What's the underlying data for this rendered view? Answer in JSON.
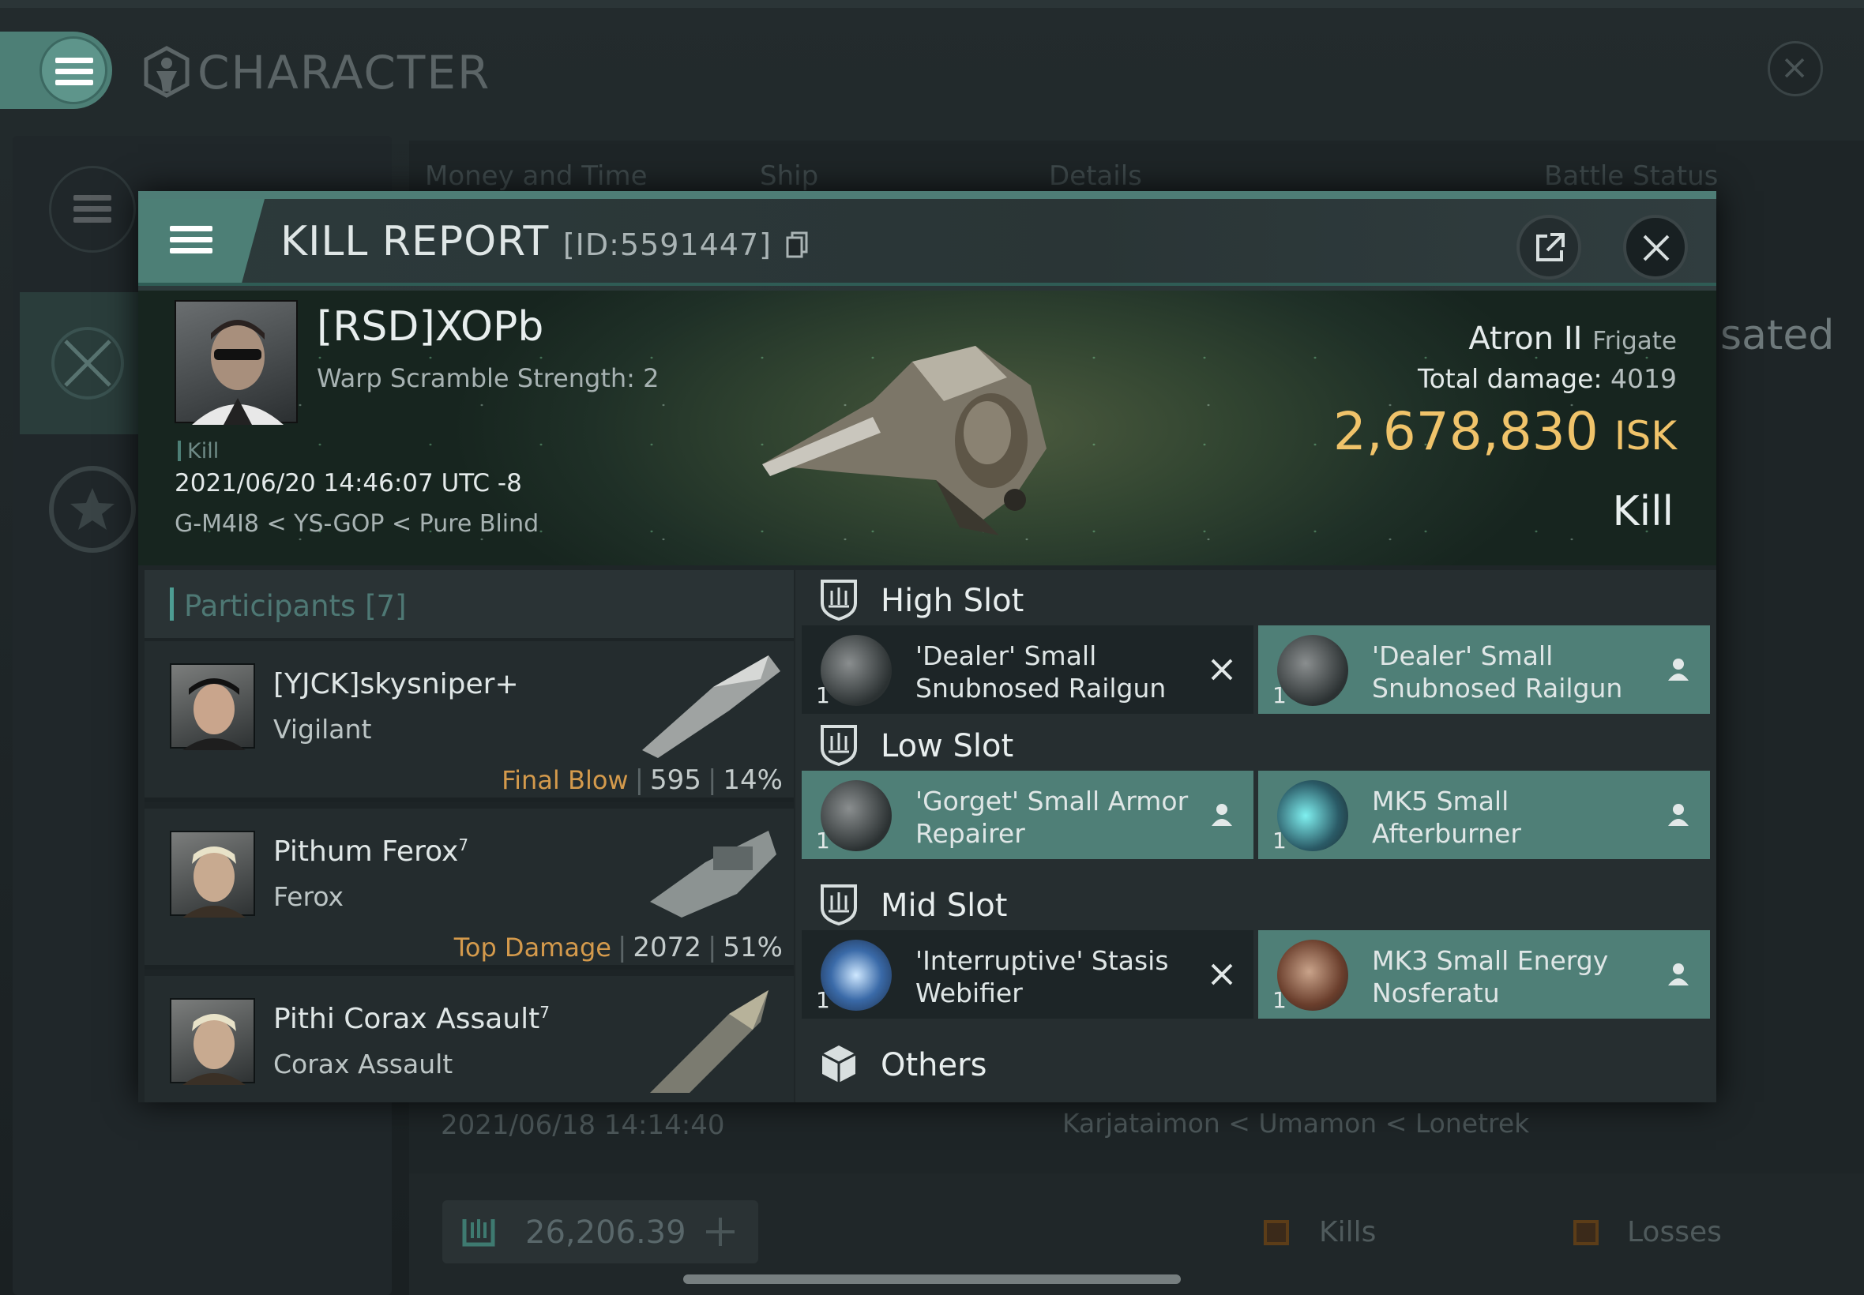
{
  "background": {
    "title": "CHARACTER",
    "tabs": [
      "Money and Time",
      "Ship",
      "Details",
      "Battle Status"
    ],
    "partial_status": "sated",
    "row": {
      "date": "2021/06/18  14:14:40",
      "location": "Karjataimon < Umamon < Lonetrek"
    },
    "isk_balance": "26,206.39",
    "legend": {
      "kills": "Kills",
      "losses": "Losses"
    }
  },
  "modal": {
    "title": "KILL REPORT",
    "id_text": "[ID:5591447]"
  },
  "victim": {
    "name": "[RSD]XOPb",
    "warp_scramble": "Warp Scramble Strength: 2",
    "tag": "Kill",
    "datetime": "2021/06/20 14:46:07 UTC -8",
    "location": "G-M4I8 < YS-GOP < Pure Blind",
    "ship_name": "Atron II",
    "ship_class": "Frigate",
    "total_damage_label": "Total damage:",
    "total_damage": "4019",
    "isk_value": "2,678,830",
    "isk_unit": "ISK",
    "result": "Kill"
  },
  "participants": {
    "title": "Participants [7]",
    "items": [
      {
        "name": "[YJCK]skysniper+",
        "sup": "",
        "ship": "Vigilant",
        "stat_label": "Final Blow",
        "damage": "595",
        "percent": "14%"
      },
      {
        "name": "Pithum Ferox",
        "sup": "7",
        "ship": "Ferox",
        "stat_label": "Top Damage",
        "damage": "2072",
        "percent": "51%"
      },
      {
        "name": "Pithi Corax Assault",
        "sup": "7",
        "ship": "Corax Assault",
        "stat_label": "",
        "damage": "",
        "percent": ""
      }
    ]
  },
  "fittings": {
    "high_slot": {
      "title": "High Slot",
      "modules": [
        {
          "qty": "1",
          "name": "'Dealer' Small Snubnosed Railgun",
          "status": "destroyed"
        },
        {
          "qty": "1",
          "name": "'Dealer' Small Snubnosed Railgun",
          "status": "dropped"
        }
      ]
    },
    "low_slot": {
      "title": "Low Slot",
      "modules": [
        {
          "qty": "1",
          "name": "'Gorget' Small Armor Repairer",
          "status": "dropped"
        },
        {
          "qty": "1",
          "name": "MK5 Small Afterburner",
          "status": "dropped"
        }
      ]
    },
    "mid_slot": {
      "title": "Mid Slot",
      "modules": [
        {
          "qty": "1",
          "name": "'Interruptive' Stasis Webifier",
          "status": "destroyed"
        },
        {
          "qty": "1",
          "name": "MK3 Small Energy Nosferatu",
          "status": "dropped"
        }
      ]
    },
    "others": {
      "title": "Others"
    }
  },
  "colors": {
    "accent": "#4d7f76",
    "isk": "#f0c36a",
    "label_orange": "#d49a4c"
  }
}
